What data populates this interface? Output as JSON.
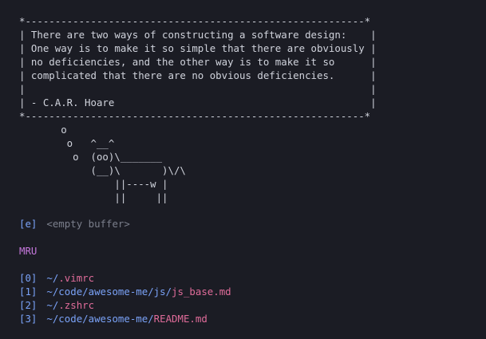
{
  "cowsay": {
    "lines": [
      "*---------------------------------------------------------*",
      "| There are two ways of constructing a software design:    |",
      "| One way is to make it so simple that there are obviously |",
      "| no deficiencies, and the other way is to make it so      |",
      "| complicated that there are no obvious deficiencies.      |",
      "|                                                          |",
      "| - C.A.R. Hoare                                           |",
      "*---------------------------------------------------------*",
      "       o",
      "        o   ^__^",
      "         o  (oo)\\_______",
      "            (__)\\       )\\/\\",
      "                ||----w |",
      "                ||     ||"
    ]
  },
  "buffer": {
    "index": "[e]",
    "label": "<empty buffer>"
  },
  "section": {
    "title": "MRU"
  },
  "mru": [
    {
      "index": "[0]",
      "dir": "~/",
      "file": ".vimrc"
    },
    {
      "index": "[1]",
      "dir": "~/code/awesome-me/js/",
      "file": "js_base.md"
    },
    {
      "index": "[2]",
      "dir": "~/",
      "file": ".zshrc"
    },
    {
      "index": "[3]",
      "dir": "~/code/awesome-me/",
      "file": "README.md"
    }
  ],
  "colors": {
    "background": "#1b1c24",
    "index": "#7aa2f7",
    "path": "#7aa2f7",
    "file": "#e06c9a",
    "section": "#c678dd",
    "muted": "#7b7f8c"
  }
}
